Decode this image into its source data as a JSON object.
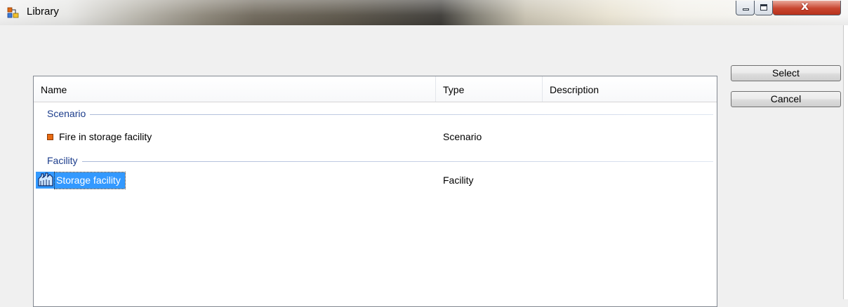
{
  "window": {
    "title": "Library",
    "controls": {
      "minimize": "minimize",
      "maximize": "maximize",
      "close": "x"
    }
  },
  "list": {
    "columns": [
      "Name",
      "Type",
      "Description"
    ],
    "groups": [
      {
        "label": "Scenario",
        "items": [
          {
            "name": "Fire in storage facility",
            "type": "Scenario",
            "description": "",
            "icon": "orange-square-icon",
            "selected": false
          }
        ]
      },
      {
        "label": "Facility",
        "items": [
          {
            "name": "Storage facility",
            "type": "Facility",
            "description": "",
            "icon": "facility-icon",
            "selected": true
          }
        ]
      }
    ]
  },
  "buttons": {
    "select": "Select",
    "cancel": "Cancel"
  },
  "colors": {
    "selection": "#3399ff",
    "group_header": "#1c3d8c",
    "scenario_icon": "#e86b12"
  }
}
